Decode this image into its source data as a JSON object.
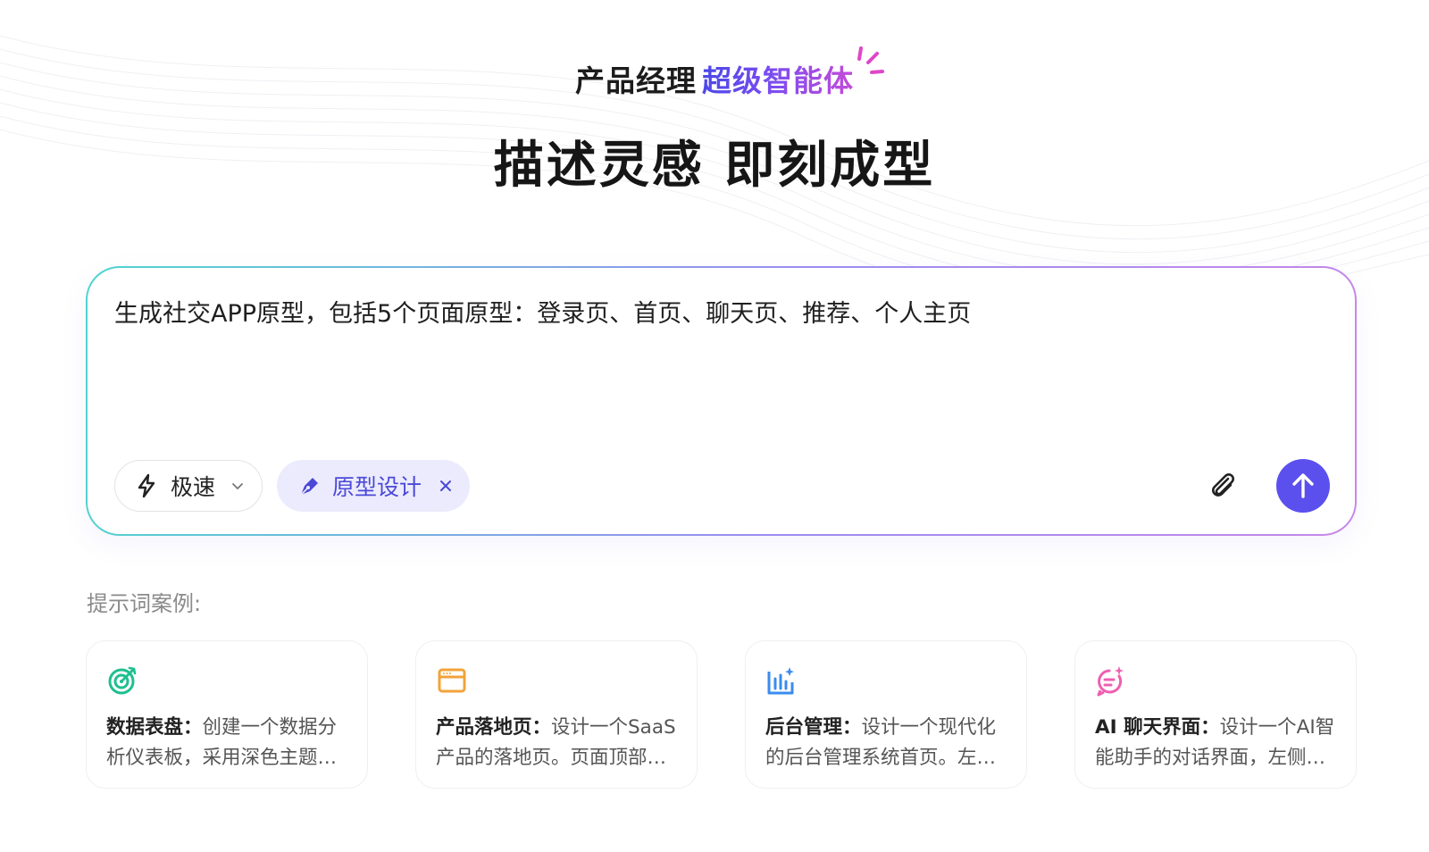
{
  "hero": {
    "subtitle_plain": "产品经理",
    "subtitle_gradient": "超级智能体",
    "title": "描述灵感 即刻成型"
  },
  "prompt": {
    "text": "生成社交APP原型，包括5个页面原型：登录页、首页、聊天页、推荐、个人主页",
    "mode_icon": "lightning-icon",
    "mode_label": "极速",
    "tag_icon": "pen-nib-icon",
    "tag_label": "原型设计",
    "attach_icon": "paperclip-icon",
    "send_icon": "arrow-up-icon"
  },
  "examples": {
    "label": "提示词案例:",
    "cards": [
      {
        "icon": "target-icon",
        "color": "#1fbf8f",
        "title": "数据表盘",
        "sep": "：",
        "text": "创建一个数据分析仪表板，采用深色主题…"
      },
      {
        "icon": "browser-window-icon",
        "color": "#f2a33a",
        "title": "产品落地页",
        "sep": "：",
        "text": "设计一个SaaS产品的落地页。页面顶部…"
      },
      {
        "icon": "bar-chart-icon",
        "color": "#3a8bef",
        "title": "后台管理",
        "sep": "：",
        "text": "设计一个现代化的后台管理系统首页。左…"
      },
      {
        "icon": "chat-bubble-icon",
        "color": "#ef5fb0",
        "title": "AI 聊天界面",
        "sep": "：",
        "text": "设计一个AI智能助手的对话界面，左侧…"
      }
    ]
  },
  "colors": {
    "accent": "#5b50ee",
    "chip_bg": "#ebebfd",
    "chip_text": "#4b48d8"
  }
}
